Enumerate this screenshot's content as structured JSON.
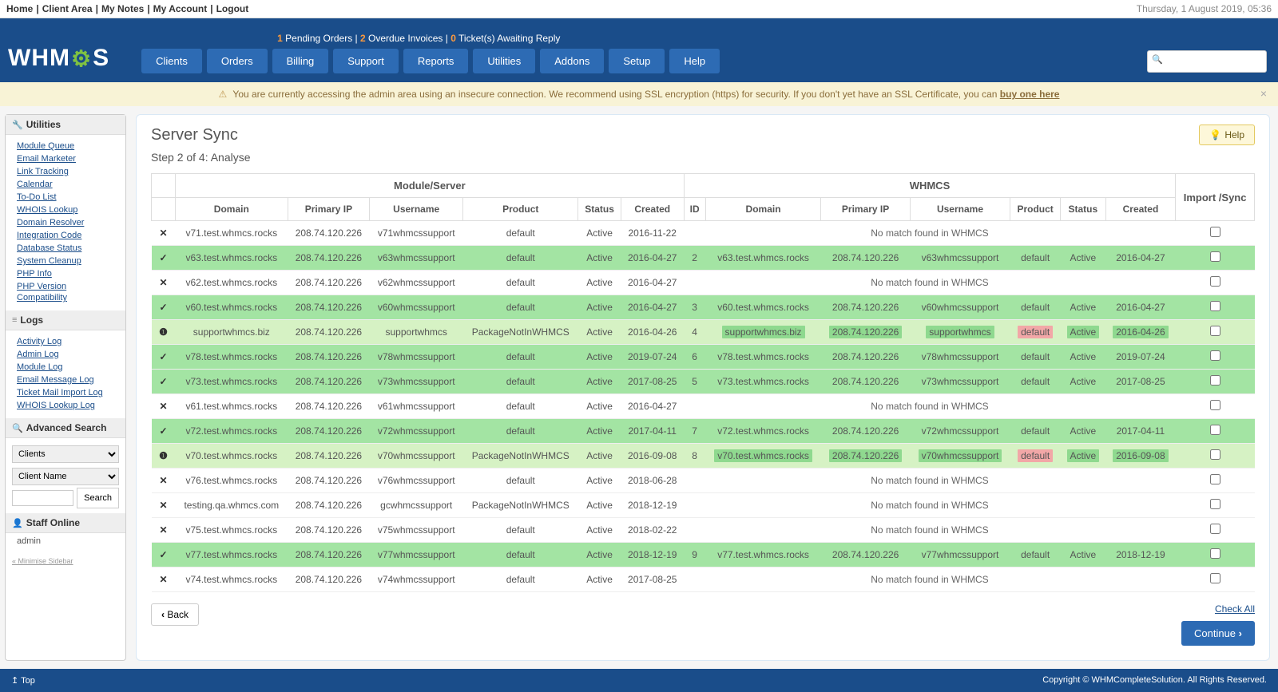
{
  "topbar": {
    "links": [
      "Home",
      "Client Area",
      "My Notes",
      "My Account",
      "Logout"
    ],
    "date": "Thursday, 1 August 2019, 05:36"
  },
  "logo": {
    "pre": "WHM",
    "post": "S"
  },
  "pending": {
    "orders_n": "1",
    "orders_t": "Pending Orders",
    "invoices_n": "2",
    "invoices_t": "Overdue Invoices",
    "tickets_n": "0",
    "tickets_t": "Ticket(s) Awaiting Reply"
  },
  "nav": [
    "Clients",
    "Orders",
    "Billing",
    "Support",
    "Reports",
    "Utilities",
    "Addons",
    "Setup",
    "Help"
  ],
  "warning": {
    "text": "You are currently accessing the admin area using an insecure connection. We recommend using SSL encryption (https) for security. If you don't yet have an SSL Certificate, you can ",
    "link": "buy one here"
  },
  "sidebar": {
    "utilities_title": "Utilities",
    "utilities": [
      "Module Queue",
      "Email Marketer",
      "Link Tracking",
      "Calendar",
      "To-Do List",
      "WHOIS Lookup",
      "Domain Resolver",
      "Integration Code",
      "Database Status",
      "System Cleanup",
      "PHP Info",
      "PHP Version Compatibility"
    ],
    "logs_title": "Logs",
    "logs": [
      "Activity Log",
      "Admin Log",
      "Module Log",
      "Email Message Log",
      "Ticket Mail Import Log",
      "WHOIS Lookup Log"
    ],
    "adv_title": "Advanced Search",
    "adv_select1": "Clients",
    "adv_select2": "Client Name",
    "adv_btn": "Search",
    "staff_title": "Staff Online",
    "staff_user": "admin",
    "minimise": "« Minimise Sidebar"
  },
  "page": {
    "title": "Server Sync",
    "help": "Help",
    "step": "Step 2 of 4: Analyse"
  },
  "table": {
    "group_left": "Module/Server",
    "group_right": "WHMCS",
    "group_import": "Import /Sync",
    "cols_left": [
      "Domain",
      "Primary IP",
      "Username",
      "Product",
      "Status",
      "Created"
    ],
    "cols_right": [
      "ID",
      "Domain",
      "Primary IP",
      "Username",
      "Product",
      "Status",
      "Created"
    ],
    "no_match": "No match found in WHMCS",
    "rows": [
      {
        "type": "nomatch",
        "domain": "v71.test.whmcs.rocks",
        "ip": "208.74.120.226",
        "user": "v71whmcssupport",
        "product": "default",
        "status": "Active",
        "created": "2016-11-22"
      },
      {
        "type": "match",
        "domain": "v63.test.whmcs.rocks",
        "ip": "208.74.120.226",
        "user": "v63whmcssupport",
        "product": "default",
        "status": "Active",
        "created": "2016-04-27",
        "id": "2",
        "rdomain": "v63.test.whmcs.rocks",
        "rip": "208.74.120.226",
        "ruser": "v63whmcssupport",
        "rproduct": "default",
        "rstatus": "Active",
        "rcreated": "2016-04-27"
      },
      {
        "type": "nomatch",
        "domain": "v62.test.whmcs.rocks",
        "ip": "208.74.120.226",
        "user": "v62whmcssupport",
        "product": "default",
        "status": "Active",
        "created": "2016-04-27"
      },
      {
        "type": "match",
        "domain": "v60.test.whmcs.rocks",
        "ip": "208.74.120.226",
        "user": "v60whmcssupport",
        "product": "default",
        "status": "Active",
        "created": "2016-04-27",
        "id": "3",
        "rdomain": "v60.test.whmcs.rocks",
        "rip": "208.74.120.226",
        "ruser": "v60whmcssupport",
        "rproduct": "default",
        "rstatus": "Active",
        "rcreated": "2016-04-27"
      },
      {
        "type": "partial",
        "domain": "supportwhmcs.biz",
        "ip": "208.74.120.226",
        "user": "supportwhmcs",
        "product": "PackageNotInWHMCS",
        "status": "Active",
        "created": "2016-04-26",
        "id": "4",
        "rdomain": "supportwhmcs.biz",
        "rip": "208.74.120.226",
        "ruser": "supportwhmcs",
        "rproduct": "default",
        "rstatus": "Active",
        "rcreated": "2016-04-26",
        "diff": {
          "rdomain": "g",
          "rip": "g",
          "ruser": "g",
          "rproduct": "r",
          "rstatus": "g",
          "rcreated": "g"
        }
      },
      {
        "type": "match",
        "domain": "v78.test.whmcs.rocks",
        "ip": "208.74.120.226",
        "user": "v78whmcssupport",
        "product": "default",
        "status": "Active",
        "created": "2019-07-24",
        "id": "6",
        "rdomain": "v78.test.whmcs.rocks",
        "rip": "208.74.120.226",
        "ruser": "v78whmcssupport",
        "rproduct": "default",
        "rstatus": "Active",
        "rcreated": "2019-07-24"
      },
      {
        "type": "match",
        "domain": "v73.test.whmcs.rocks",
        "ip": "208.74.120.226",
        "user": "v73whmcssupport",
        "product": "default",
        "status": "Active",
        "created": "2017-08-25",
        "id": "5",
        "rdomain": "v73.test.whmcs.rocks",
        "rip": "208.74.120.226",
        "ruser": "v73whmcssupport",
        "rproduct": "default",
        "rstatus": "Active",
        "rcreated": "2017-08-25"
      },
      {
        "type": "nomatch",
        "domain": "v61.test.whmcs.rocks",
        "ip": "208.74.120.226",
        "user": "v61whmcssupport",
        "product": "default",
        "status": "Active",
        "created": "2016-04-27"
      },
      {
        "type": "match",
        "domain": "v72.test.whmcs.rocks",
        "ip": "208.74.120.226",
        "user": "v72whmcssupport",
        "product": "default",
        "status": "Active",
        "created": "2017-04-11",
        "id": "7",
        "rdomain": "v72.test.whmcs.rocks",
        "rip": "208.74.120.226",
        "ruser": "v72whmcssupport",
        "rproduct": "default",
        "rstatus": "Active",
        "rcreated": "2017-04-11"
      },
      {
        "type": "partial",
        "domain": "v70.test.whmcs.rocks",
        "ip": "208.74.120.226",
        "user": "v70whmcssupport",
        "product": "PackageNotInWHMCS",
        "status": "Active",
        "created": "2016-09-08",
        "id": "8",
        "rdomain": "v70.test.whmcs.rocks",
        "rip": "208.74.120.226",
        "ruser": "v70whmcssupport",
        "rproduct": "default",
        "rstatus": "Active",
        "rcreated": "2016-09-08",
        "diff": {
          "rdomain": "g",
          "rip": "g",
          "ruser": "g",
          "rproduct": "r",
          "rstatus": "g",
          "rcreated": "g"
        }
      },
      {
        "type": "nomatch",
        "domain": "v76.test.whmcs.rocks",
        "ip": "208.74.120.226",
        "user": "v76whmcssupport",
        "product": "default",
        "status": "Active",
        "created": "2018-06-28"
      },
      {
        "type": "nomatch",
        "domain": "testing.qa.whmcs.com",
        "ip": "208.74.120.226",
        "user": "gcwhmcssupport",
        "product": "PackageNotInWHMCS",
        "status": "Active",
        "created": "2018-12-19"
      },
      {
        "type": "nomatch",
        "domain": "v75.test.whmcs.rocks",
        "ip": "208.74.120.226",
        "user": "v75whmcssupport",
        "product": "default",
        "status": "Active",
        "created": "2018-02-22"
      },
      {
        "type": "match",
        "domain": "v77.test.whmcs.rocks",
        "ip": "208.74.120.226",
        "user": "v77whmcssupport",
        "product": "default",
        "status": "Active",
        "created": "2018-12-19",
        "id": "9",
        "rdomain": "v77.test.whmcs.rocks",
        "rip": "208.74.120.226",
        "ruser": "v77whmcssupport",
        "rproduct": "default",
        "rstatus": "Active",
        "rcreated": "2018-12-19"
      },
      {
        "type": "nomatch",
        "domain": "v74.test.whmcs.rocks",
        "ip": "208.74.120.226",
        "user": "v74whmcssupport",
        "product": "default",
        "status": "Active",
        "created": "2017-08-25"
      }
    ]
  },
  "actions": {
    "back": "Back",
    "checkall": "Check All",
    "continue": "Continue"
  },
  "footer": {
    "top": "Top",
    "copyright": "Copyright © WHMCompleteSolution. All Rights Reserved."
  }
}
